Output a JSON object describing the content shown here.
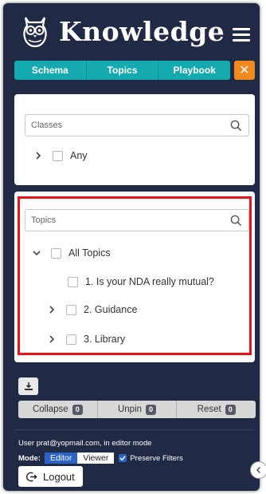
{
  "header": {
    "brand": "Knowledge",
    "logo_icon": "owl-icon",
    "menu_icon": "hamburger-icon"
  },
  "tabs": [
    {
      "label": "Schema"
    },
    {
      "label": "Topics"
    },
    {
      "label": "Playbook"
    }
  ],
  "close_button": {
    "label": "✕"
  },
  "classes": {
    "search_placeholder": "Classes",
    "items": [
      {
        "label": "Any",
        "expanded": false,
        "checked": false
      }
    ]
  },
  "topics": {
    "search_placeholder": "Topics",
    "items": [
      {
        "label": "All Topics",
        "expanded": true,
        "checked": false,
        "level": 0
      },
      {
        "label": "1. Is your NDA really mutual?",
        "checked": false,
        "level": 2
      },
      {
        "label": "2. Guidance",
        "expanded": false,
        "checked": false,
        "level": 1
      },
      {
        "label": "3. Library",
        "expanded": false,
        "checked": false,
        "level": 1
      }
    ]
  },
  "actions": {
    "collapse": {
      "label": "Collapse",
      "count": "0"
    },
    "unpin": {
      "label": "Unpin",
      "count": "0"
    },
    "reset": {
      "label": "Reset",
      "count": "0"
    }
  },
  "footer": {
    "user_info": "User prat@yopmail.com, in editor mode",
    "mode_label": "Mode:",
    "editor_label": "Editor",
    "viewer_label": "Viewer",
    "preserve_filters_label": "Preserve Filters",
    "preserve_filters_checked": true,
    "logout_label": "Logout"
  },
  "colors": {
    "background": "#202a44",
    "tab": "#14aab0",
    "close": "#f08a1e",
    "highlight": "#e8141a",
    "active_mode": "#2a64c8"
  }
}
